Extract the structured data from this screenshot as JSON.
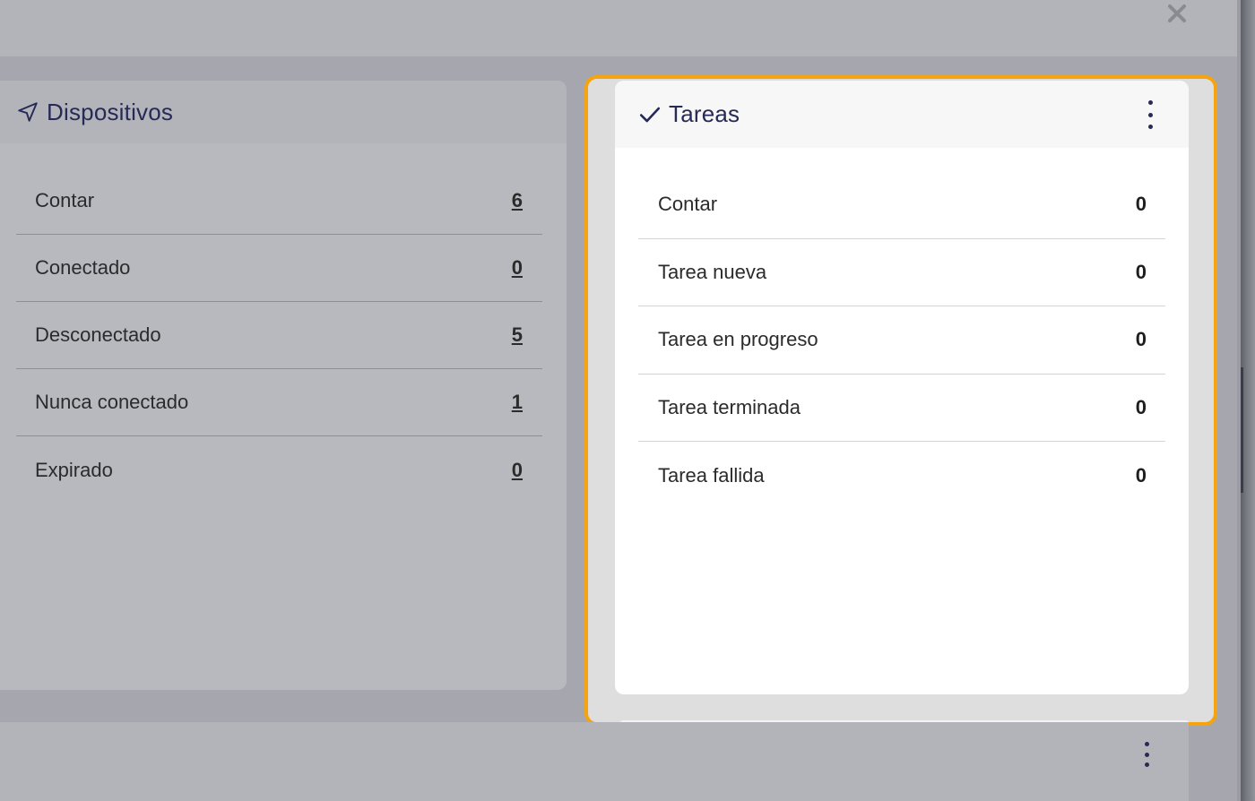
{
  "dialog": {
    "close_icon": "close-icon"
  },
  "devices_card": {
    "title": "Dispositivos",
    "icon": "navigation-arrow-icon",
    "rows": [
      {
        "label": "Contar",
        "value": "6"
      },
      {
        "label": "Conectado",
        "value": "0"
      },
      {
        "label": "Desconectado",
        "value": "5"
      },
      {
        "label": "Nunca conectado",
        "value": "1"
      },
      {
        "label": "Expirado",
        "value": "0"
      }
    ]
  },
  "tasks_card": {
    "title": "Tareas",
    "icon": "check-icon",
    "menu_icon": "more-vertical-icon",
    "rows": [
      {
        "label": "Contar",
        "value": "0"
      },
      {
        "label": "Tarea nueva",
        "value": "0"
      },
      {
        "label": "Tarea en progreso",
        "value": "0"
      },
      {
        "label": "Tarea terminada",
        "value": "0"
      },
      {
        "label": "Tarea fallida",
        "value": "0"
      }
    ]
  },
  "colors": {
    "highlight": "#f5a30f",
    "accent": "#262a55",
    "overlay": "#a6a7ae"
  }
}
